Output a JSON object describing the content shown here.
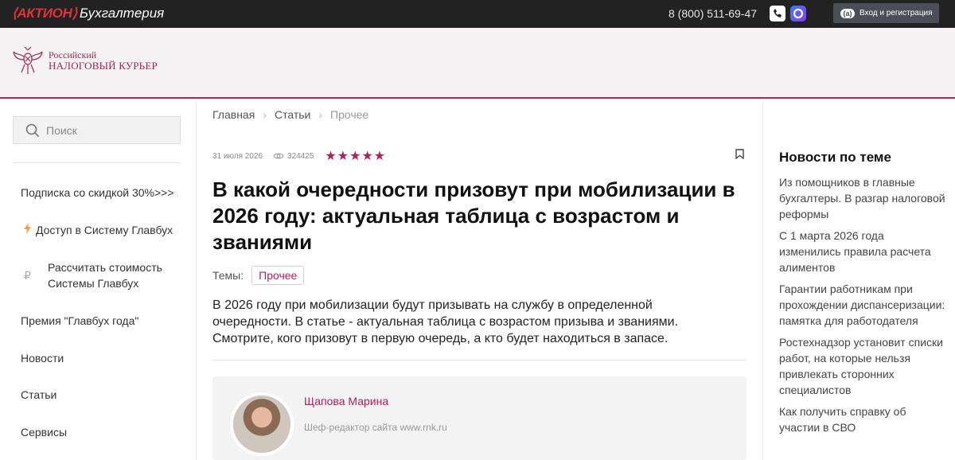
{
  "topbar": {
    "brand_aktion": "⟨АКТИОН⟩",
    "brand_sub": "Бухгалтерия",
    "phone": "8 (800) 511-69-47",
    "login_label": "Вход и регистрация",
    "login_logo": "(а)"
  },
  "header": {
    "logo_line1": "Российский",
    "logo_line2": "НАЛОГОВЫЙ КУРЬЕР"
  },
  "sidebar": {
    "search_placeholder": "Поиск",
    "items": [
      {
        "label": "Подписка со скидкой 30%>>>",
        "icon": ""
      },
      {
        "label": "Доступ в Систему Главбух",
        "icon": "lightning-icon"
      },
      {
        "label": "Рассчитать стоимость Системы Главбух",
        "icon": "ruble-icon"
      },
      {
        "label": "Премия \"Главбух года\"",
        "icon": ""
      },
      {
        "label": "Новости",
        "icon": ""
      },
      {
        "label": "Статьи",
        "icon": ""
      },
      {
        "label": "Сервисы",
        "icon": ""
      }
    ]
  },
  "breadcrumb": [
    "Главная",
    "Статьи",
    "Прочее"
  ],
  "article": {
    "date": "31 июля 2026",
    "views": "324425",
    "rating": 5,
    "title": "В какой очередности призовут при мобилизации в 2026 году: актуальная таблица с возрастом и званиями",
    "topics_label": "Темы:",
    "topic": "Прочее",
    "lead": "В 2026 году при мобилизации будут призывать на службу в определенной очередности. В статье - актуальная таблица с возрастом призыва и званиями. Смотрите, кого призовут в первую очередь, а кто будет находиться в запасе.",
    "author_name": "Щапова Марина",
    "author_role": "Шеф-редактор сайта www.rnk.ru"
  },
  "related": {
    "heading": "Новости по теме",
    "items": [
      "Из помощников в главные бухгалтеры. В разгар налоговой реформы",
      "С 1 марта 2026 года изменились правила расчета алиментов",
      "Гарантии работникам при прохождении диспансеризации: памятка для работодателя",
      "Ростехнадзор установит списки работ, на которые нельзя привлекать сторонних специалистов",
      "Как получить справку об участии в СВО"
    ]
  },
  "colors": {
    "accent": "#b0205a",
    "topbar": "#222222",
    "brand_red": "#e0323a"
  }
}
